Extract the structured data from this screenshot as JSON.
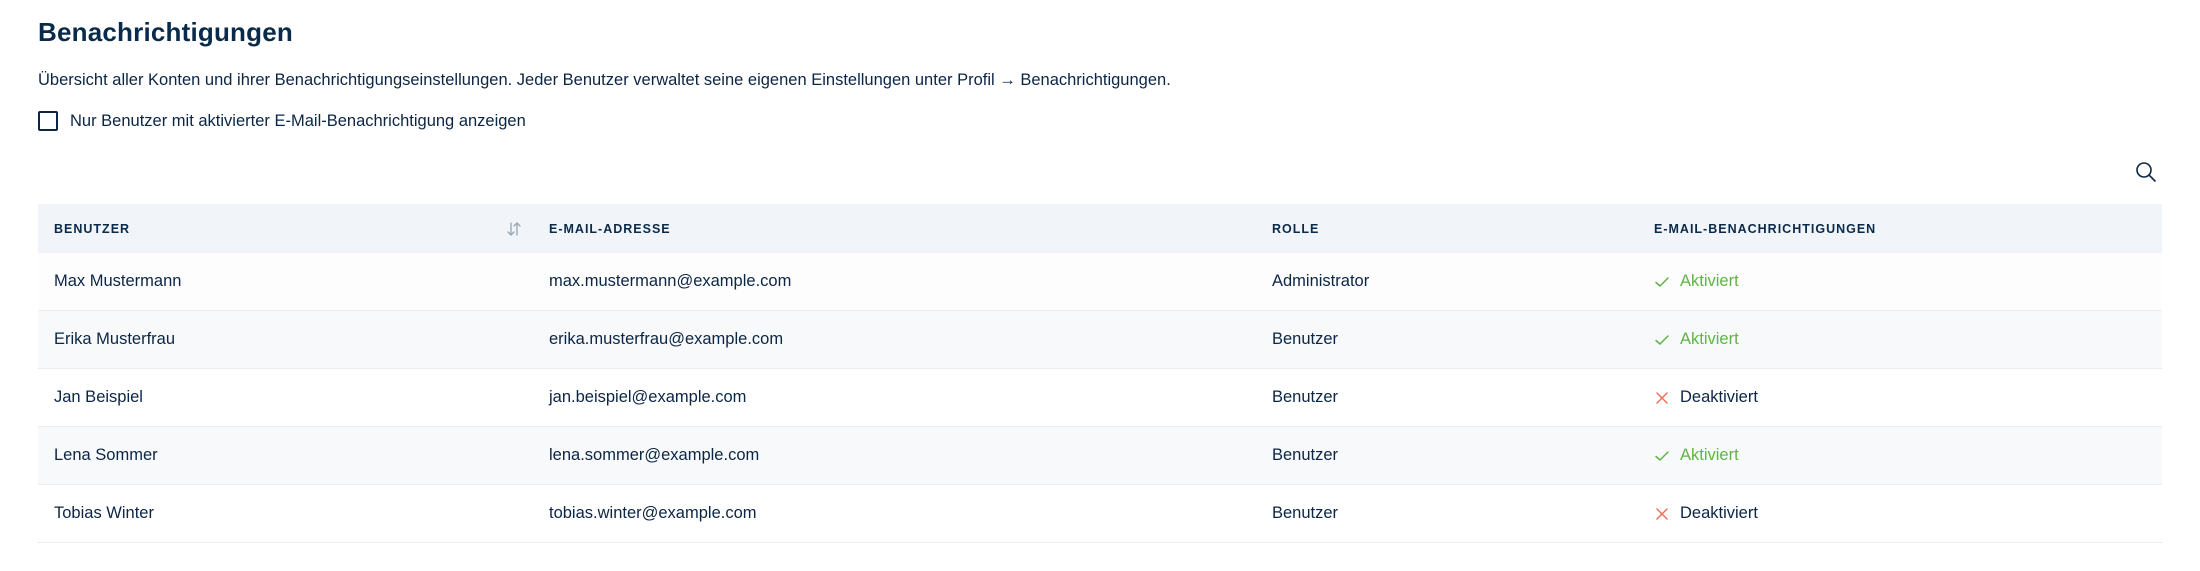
{
  "page": {
    "title": "Benachrichtigungen",
    "description": "Übersicht aller Konten und ihrer Benachrichtigungseinstellungen. Jeder Benutzer verwaltet seine eigenen Einstellungen unter Profil → Benachrichtigungen."
  },
  "filter": {
    "label": "Nur Benutzer mit aktivierter E-Mail-Benachrichtigung anzeigen",
    "checked": false
  },
  "search": {
    "icon": "search-icon"
  },
  "table": {
    "headers": [
      "BENUTZER",
      "E-MAIL-ADRESSE",
      "ROLLE",
      "E-MAIL-BENACHRICHTIGUNGEN"
    ],
    "sort_icon": "sort-icon",
    "rows": [
      {
        "name": "Max Mustermann",
        "email": "max.mustermann@example.com",
        "role": "Administrator",
        "status": "Aktiviert",
        "enabled": true
      },
      {
        "name": "Erika Musterfrau",
        "email": "erika.musterfrau@example.com",
        "role": "Benutzer",
        "status": "Aktiviert",
        "enabled": true
      },
      {
        "name": "Jan Beispiel",
        "email": "jan.beispiel@example.com",
        "role": "Benutzer",
        "status": "Deaktiviert",
        "enabled": false
      },
      {
        "name": "Lena Sommer",
        "email": "lena.sommer@example.com",
        "role": "Benutzer",
        "status": "Aktiviert",
        "enabled": true
      },
      {
        "name": "Tobias Winter",
        "email": "tobias.winter@example.com",
        "role": "Benutzer",
        "status": "Deaktiviert",
        "enabled": false
      }
    ]
  },
  "colors": {
    "text": "#0b2545",
    "header_bg": "#f1f4f8",
    "enabled": "#5fb544",
    "disabled_icon": "#e8705d"
  }
}
